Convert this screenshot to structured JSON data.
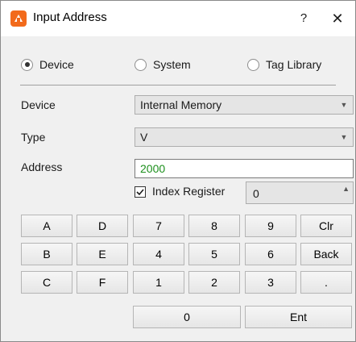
{
  "window": {
    "title": "Input Address",
    "help_glyph": "?",
    "close_glyph": "✕"
  },
  "radios": [
    {
      "label": "Device",
      "checked": true
    },
    {
      "label": "System",
      "checked": false
    },
    {
      "label": "Tag Library",
      "checked": false
    }
  ],
  "form": {
    "device_label": "Device",
    "device_value": "Internal Memory",
    "type_label": "Type",
    "type_value": "V",
    "address_label": "Address",
    "address_value": "2000",
    "address_color": "#1c8f1c",
    "index_register_label": "Index Register",
    "index_register_checked": true,
    "index_register_value": "0"
  },
  "keypad": {
    "row1": [
      "A",
      "D",
      "7",
      "8",
      "9",
      "Clr"
    ],
    "row2": [
      "B",
      "E",
      "4",
      "5",
      "6",
      "Back"
    ],
    "row3": [
      "C",
      "F",
      "1",
      "2",
      "3",
      "."
    ],
    "zero": "0",
    "enter": "Ent"
  },
  "icons": {
    "app": "app-logo-icon",
    "combo_arrow": "chevron-down-icon",
    "spin_arrow": "chevron-up-icon",
    "check": "checkmark-icon"
  },
  "colors": {
    "app_icon": "#f26a1b",
    "background": "#f0f0f0"
  }
}
